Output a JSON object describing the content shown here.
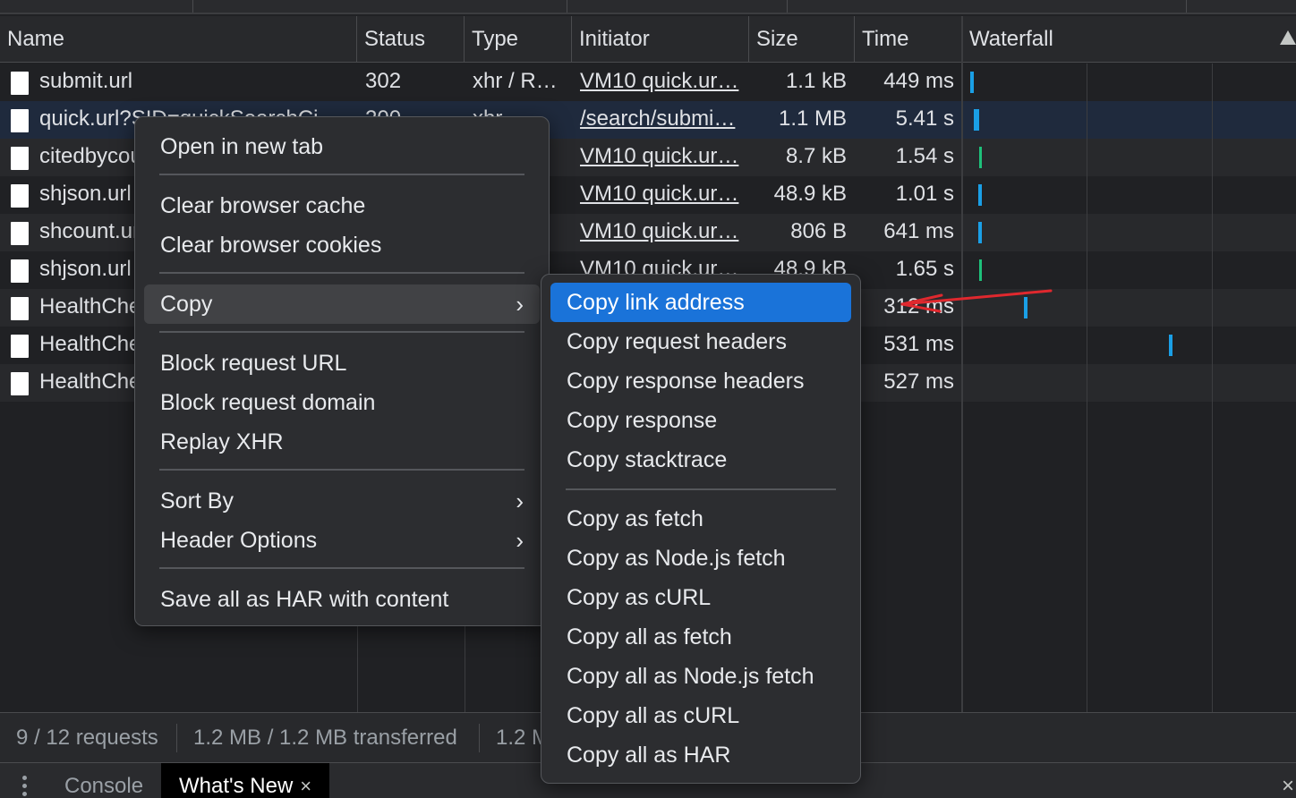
{
  "columns": [
    "Name",
    "Status",
    "Type",
    "Initiator",
    "Size",
    "Time",
    "Waterfall"
  ],
  "rows": [
    {
      "name": "submit.url",
      "status": "302",
      "type": "xhr / R…",
      "initiator": "VM10 quick.ur…",
      "size": "1.1 kB",
      "time": "449 ms"
    },
    {
      "name": "quick.url?SID=quickSearchCi…",
      "status": "200",
      "type": "xhr",
      "initiator": "/search/submi…",
      "size": "1.1 MB",
      "time": "5.41 s"
    },
    {
      "name": "citedbycount.url",
      "status": "",
      "type": "",
      "initiator": "VM10 quick.ur…",
      "size": "8.7 kB",
      "time": "1.54 s"
    },
    {
      "name": "shjson.url",
      "status": "",
      "type": "",
      "initiator": "VM10 quick.ur…",
      "size": "48.9 kB",
      "time": "1.01 s"
    },
    {
      "name": "shcount.url",
      "status": "",
      "type": "",
      "initiator": "VM10 quick.ur…",
      "size": "806 B",
      "time": "641 ms"
    },
    {
      "name": "shjson.url",
      "status": "",
      "type": "",
      "initiator": "VM10 quick.ur…",
      "size": "48.9 kB",
      "time": "1.65 s"
    },
    {
      "name": "HealthCheck",
      "status": "",
      "type": "",
      "initiator": "",
      "size": "",
      "time": "312 ms"
    },
    {
      "name": "HealthCheck",
      "status": "",
      "type": "",
      "initiator": "",
      "size": "",
      "time": "531 ms"
    },
    {
      "name": "HealthCheck",
      "status": "",
      "type": "",
      "initiator": "",
      "size": "",
      "time": "527 ms"
    }
  ],
  "status_bar": {
    "requests": "9 / 12 requests",
    "transferred": "1.2 MB / 1.2 MB transferred",
    "resources": "1.2 MB"
  },
  "drawer": {
    "tabs": [
      "Console",
      "What's New"
    ],
    "active_tab": "What's New",
    "close_glyph": "×"
  },
  "context_menu": {
    "items": [
      "Open in new tab",
      "Clear browser cache",
      "Clear browser cookies",
      "Copy",
      "Block request URL",
      "Block request domain",
      "Replay XHR",
      "Sort By",
      "Header Options",
      "Save all as HAR with content"
    ],
    "hovered": "Copy",
    "submenu_glyph": "›"
  },
  "copy_submenu": {
    "items": [
      "Copy link address",
      "Copy request headers",
      "Copy response headers",
      "Copy response",
      "Copy stacktrace",
      "Copy as fetch",
      "Copy as Node.js fetch",
      "Copy as cURL",
      "Copy all as fetch",
      "Copy all as Node.js fetch",
      "Copy all as cURL",
      "Copy all as HAR"
    ],
    "highlighted": "Copy link address"
  },
  "colors": {
    "background": "#202124",
    "highlight": "#1a73d9",
    "annotation_arrow": "#e0282e",
    "waterfall_bar": "#1a9fe6"
  }
}
